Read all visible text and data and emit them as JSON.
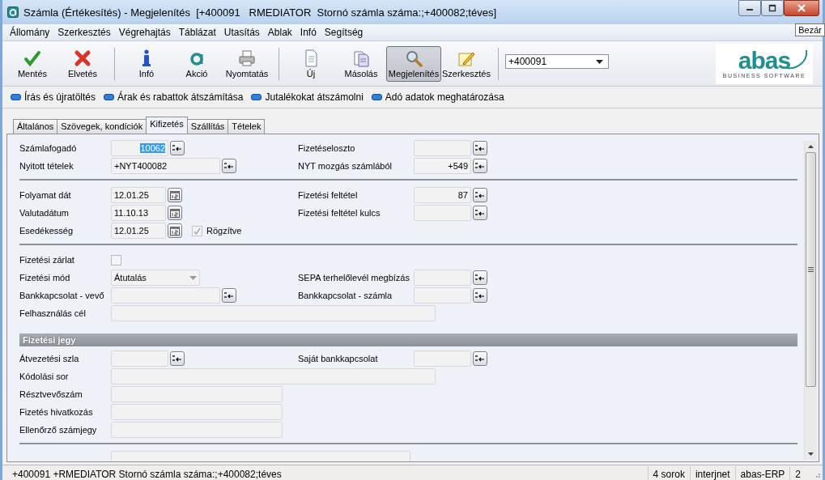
{
  "window": {
    "title": "Számla (Értékesítés) - Megjelenítés  [+400091   RMEDIATOR  Stornó számla száma:;+400082;téves]"
  },
  "tooltip": {
    "text": "Bezár"
  },
  "menu": [
    "Állomány",
    "Szerkesztés",
    "Végrehajtás",
    "Táblázat",
    "Utasítás",
    "Ablak",
    "Infó",
    "Segítség"
  ],
  "toolbar": {
    "groups": [
      [
        {
          "label": "Mentés",
          "kind": "save",
          "selected": false
        },
        {
          "label": "Elvetés",
          "kind": "discard",
          "selected": false
        }
      ],
      [
        {
          "label": "Infó",
          "kind": "info",
          "selected": false
        },
        {
          "label": "Akció",
          "kind": "action",
          "selected": false
        },
        {
          "label": "Nyomtatás",
          "kind": "print",
          "selected": false
        }
      ],
      [
        {
          "label": "Új",
          "kind": "new",
          "selected": false
        },
        {
          "label": "Másolás",
          "kind": "copy",
          "selected": false
        },
        {
          "label": "Megjelenítés",
          "kind": "view",
          "selected": true
        },
        {
          "label": "Szerkesztés",
          "kind": "edit",
          "selected": false
        }
      ]
    ],
    "record": {
      "value": "+400091"
    },
    "logo": {
      "name": "abas",
      "tagline": "BUSINESS SOFTWARE"
    }
  },
  "actions": [
    "Írás és újratöltés",
    "Árak és rabattok átszámítása",
    "Jutalékokat átszámolni",
    "Adó adatok meghatározása"
  ],
  "tabs": [
    {
      "label": "Általános",
      "selected": false
    },
    {
      "label": "Szövegek, kondíciók",
      "selected": false
    },
    {
      "label": "Kifizetés",
      "selected": true
    },
    {
      "label": "Szállítás",
      "selected": false
    },
    {
      "label": "Tételek",
      "selected": false
    }
  ],
  "form": [
    {
      "kind": "rows",
      "rows": [
        {
          "left": {
            "label": "Számlafogadó",
            "kind": "amount",
            "value": "10062",
            "highlighted": true
          },
          "right": {
            "label": "Fizetéseloszto",
            "kind": "amount"
          }
        },
        {
          "left": {
            "label": "Nyitott tételek",
            "kind": "lookup",
            "value": "+NYT400082",
            "highlighted": false
          },
          "right": {
            "label": "NYT mozgás számlából",
            "kind": "amount",
            "value": "+549",
            "highlighted": false
          }
        }
      ]
    },
    {
      "kind": "rows",
      "rows": [
        {
          "left": {
            "label": "Folyamat dát",
            "kind": "date",
            "value": "12.01.25",
            "highlighted": false
          },
          "right": {
            "label": "Fizetési feltétel",
            "kind": "amount",
            "value": "87",
            "highlighted": false
          }
        },
        {
          "left": {
            "label": "Valutadátum",
            "kind": "date",
            "value": "11.10.13",
            "highlighted": false
          },
          "right": {
            "label": "Fizetési feltétel kulcs",
            "kind": "amount"
          }
        },
        {
          "left": {
            "label": "Esedékesség",
            "kind": "date",
            "value": "12.01.25",
            "highlighted": false,
            "flag": {
              "label": "Rögzítve",
              "checked": true,
              "disabled": true
            }
          }
        }
      ]
    },
    {
      "kind": "rows",
      "rows": [
        {
          "left": {
            "label": "Fizetési zárlat",
            "kind": "checkbox",
            "checked": false
          }
        },
        {
          "left": {
            "label": "Fizetési mód",
            "kind": "dropdown",
            "value": "Átutalás",
            "highlighted": false
          },
          "right": {
            "label": "SEPA terhelőlevél megbízás",
            "kind": "amount"
          }
        },
        {
          "left": {
            "label": "Bankkapcsolat - vevő",
            "kind": "lookup"
          },
          "right": {
            "label": "Bankkapcsolat - számla",
            "kind": "amount"
          }
        },
        {
          "left": {
            "label": "Felhasználás cél",
            "kind": "line"
          }
        }
      ]
    },
    {
      "kind": "header",
      "title": "Fizetési jegy"
    },
    {
      "kind": "rows",
      "rows": [
        {
          "left": {
            "label": "Átvezetési szla",
            "kind": "amount"
          },
          "right": {
            "label": "Saját bankkapcsolat",
            "kind": "amount"
          }
        },
        {
          "left": {
            "label": "Kódolási sor",
            "kind": "line"
          }
        },
        {
          "left": {
            "label": "Résztvevőszám",
            "kind": "entry"
          }
        },
        {
          "left": {
            "label": "Fizetés hivatkozás",
            "kind": "entry"
          }
        },
        {
          "left": {
            "label": "Ellenőrző számjegy",
            "kind": "entry"
          }
        }
      ]
    },
    {
      "kind": "rows",
      "rows": [
        {
          "left": {
            "kind": "wide"
          }
        }
      ]
    }
  ],
  "status_bar": {
    "message": "+400091 +RMEDIATOR Stornó számla száma:;+400082;téves",
    "panels": [
      "4 sorok",
      "interjnet",
      "abas-ERP",
      "2"
    ]
  }
}
